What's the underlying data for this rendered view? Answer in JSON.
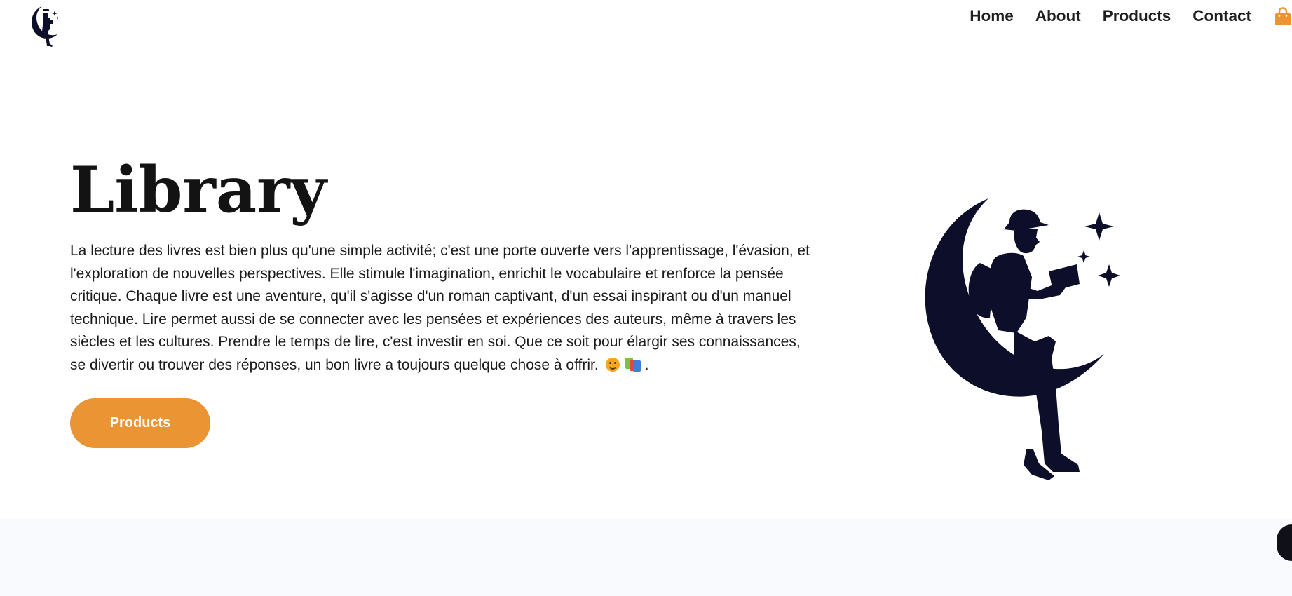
{
  "nav": {
    "logo_icon": "moon-reader-logo-icon",
    "links": [
      {
        "label": "Home"
      },
      {
        "label": "About"
      },
      {
        "label": "Products"
      },
      {
        "label": "Contact"
      }
    ],
    "cart_icon": "shopping-bag-icon"
  },
  "hero": {
    "title": "Library",
    "paragraph": "La lecture des livres est bien plus qu'une simple activité; c'est une porte ouverte vers l'apprentissage, l'évasion, et l'exploration de nouvelles perspectives. Elle stimule l'imagination, enrichit le vocabulaire et renforce la pensée critique. Chaque livre est une aventure, qu'il s'agisse d'un roman captivant, d'un essai inspirant ou d'un manuel technique. Lire permet aussi de se connecter avec les pensées et expériences des auteurs, même à travers les siècles et les cultures. Prendre le temps de lire, c'est investir en soi. Que ce soit pour élargir ses connaissances, se divertir ou trouver des réponses, un bon livre a toujours quelque chose à offrir.",
    "trailing_emojis": [
      "smiling-face-emoji",
      "books-emoji"
    ],
    "trailing_text": ".",
    "button_label": "Products",
    "illustration": "boy-reading-on-crescent-moon-illustration"
  },
  "colors": {
    "accent": "#ea9434",
    "silhouette": "#0d0f2a",
    "text": "#1b1b1b",
    "section_bg": "#f9fafd"
  }
}
